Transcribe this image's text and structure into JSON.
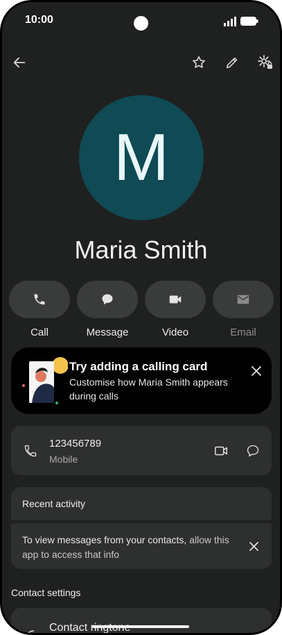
{
  "status_bar": {
    "time": "10:00"
  },
  "toolbar": {
    "icons": [
      "back-arrow-icon",
      "star-icon",
      "edit-pencil-icon",
      "settings-gear-icon"
    ]
  },
  "contact": {
    "initial": "M",
    "name": "Maria Smith",
    "avatar_color": "#0f4a55"
  },
  "actions": [
    {
      "label": "Call",
      "icon": "phone-icon"
    },
    {
      "label": "Message",
      "icon": "message-bubble-icon"
    },
    {
      "label": "Video",
      "icon": "video-camera-icon"
    },
    {
      "label": "Email",
      "icon": "email-icon",
      "disabled": true
    }
  ],
  "promo": {
    "title": "Try adding a calling card",
    "body": "Customise how Maria Smith appears during calls"
  },
  "phone_entry": {
    "number": "123456789",
    "type": "Mobile"
  },
  "recent_activity": {
    "heading": "Recent activity",
    "message": "To view messages from your contacts,",
    "link": "allow this app to access that info"
  },
  "contact_settings": {
    "heading": "Contact settings",
    "ringtone_label": "Contact ringtone"
  }
}
